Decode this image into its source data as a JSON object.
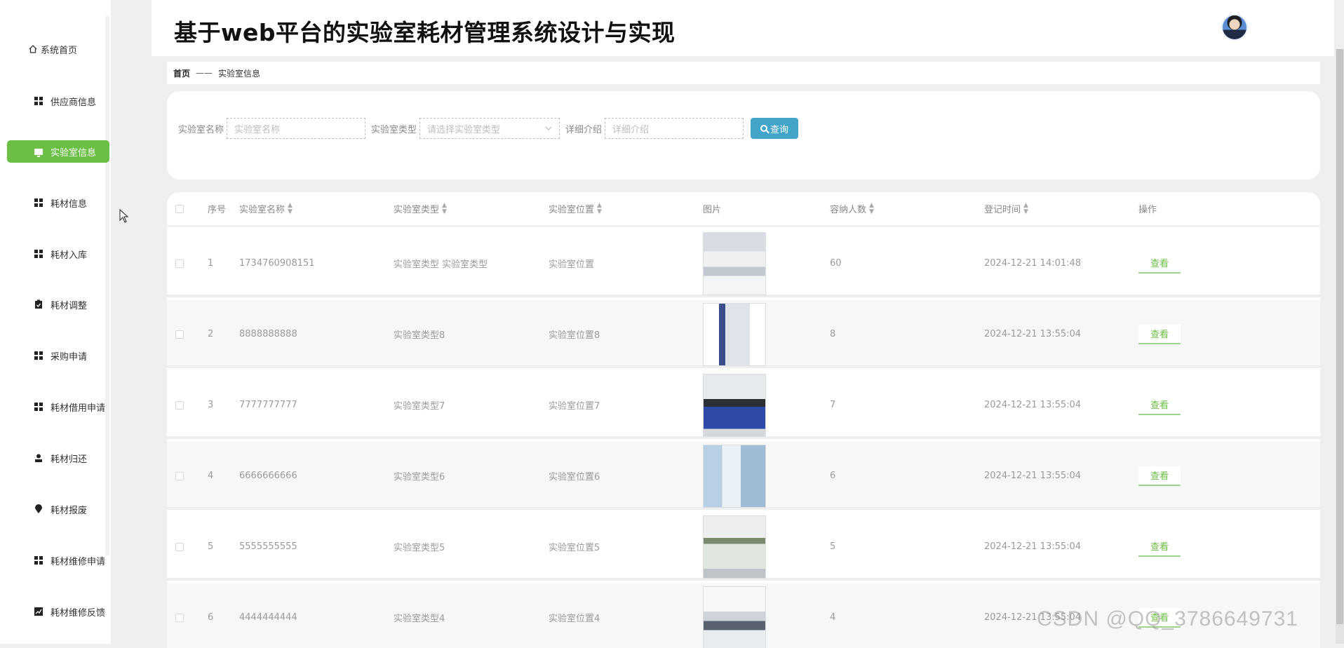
{
  "header": {
    "title": "基于web平台的实验室耗材管理系统设计与实现"
  },
  "sidebar": {
    "items": [
      {
        "label": "系统首页",
        "icon": "home-icon"
      },
      {
        "label": "供应商信息",
        "icon": "grid-icon"
      },
      {
        "label": "实验室信息",
        "icon": "monitor-icon",
        "active": true
      },
      {
        "label": "耗材信息",
        "icon": "grid-icon"
      },
      {
        "label": "耗材入库",
        "icon": "grid-icon"
      },
      {
        "label": "耗材调整",
        "icon": "clipboard-icon"
      },
      {
        "label": "采购申请",
        "icon": "grid-icon"
      },
      {
        "label": "耗材借用申请",
        "icon": "grid-icon"
      },
      {
        "label": "耗材归还",
        "icon": "user-icon"
      },
      {
        "label": "耗材报废",
        "icon": "pin-icon"
      },
      {
        "label": "耗材维修申请",
        "icon": "grid-icon"
      },
      {
        "label": "耗材维修反馈",
        "icon": "chart-icon"
      }
    ],
    "active_color": "#6bbf45"
  },
  "breadcrumb": {
    "home": "首页",
    "separator": "——",
    "current": "实验室信息"
  },
  "search": {
    "name_label": "实验室名称",
    "name_placeholder": "实验室名称",
    "type_label": "实验室类型",
    "type_placeholder": "请选择实验室类型",
    "detail_label": "详细介绍",
    "detail_placeholder": "详细介绍",
    "query_label": "查询",
    "query_color": "#42a4c9"
  },
  "table": {
    "headers": {
      "no": "序号",
      "name": "实验室名称",
      "type": "实验室类型",
      "location": "实验室位置",
      "image": "图片",
      "capacity": "容纳人数",
      "time": "登记时间",
      "op": "操作"
    },
    "rows": [
      {
        "no": "1",
        "name": "1734760908151",
        "type": "实验室类型 实验室类型",
        "location": "实验室位置",
        "capacity": "60",
        "time": "2024-12-21 14:01:48",
        "op": "查看"
      },
      {
        "no": "2",
        "name": "8888888888",
        "type": "实验室类型8",
        "location": "实验室位置8",
        "capacity": "8",
        "time": "2024-12-21 13:55:04",
        "op": "查看"
      },
      {
        "no": "3",
        "name": "7777777777",
        "type": "实验室类型7",
        "location": "实验室位置7",
        "capacity": "7",
        "time": "2024-12-21 13:55:04",
        "op": "查看"
      },
      {
        "no": "4",
        "name": "6666666666",
        "type": "实验室类型6",
        "location": "实验室位置6",
        "capacity": "6",
        "time": "2024-12-21 13:55:04",
        "op": "查看"
      },
      {
        "no": "5",
        "name": "5555555555",
        "type": "实验室类型5",
        "location": "实验室位置5",
        "capacity": "5",
        "time": "2024-12-21 13:55:04",
        "op": "查看"
      },
      {
        "no": "6",
        "name": "4444444444",
        "type": "实验室类型4",
        "location": "实验室位置4",
        "capacity": "4",
        "time": "2024-12-21 13:55:04",
        "op": "查看"
      }
    ]
  },
  "watermark": "CSDN @QQ_3786649731"
}
